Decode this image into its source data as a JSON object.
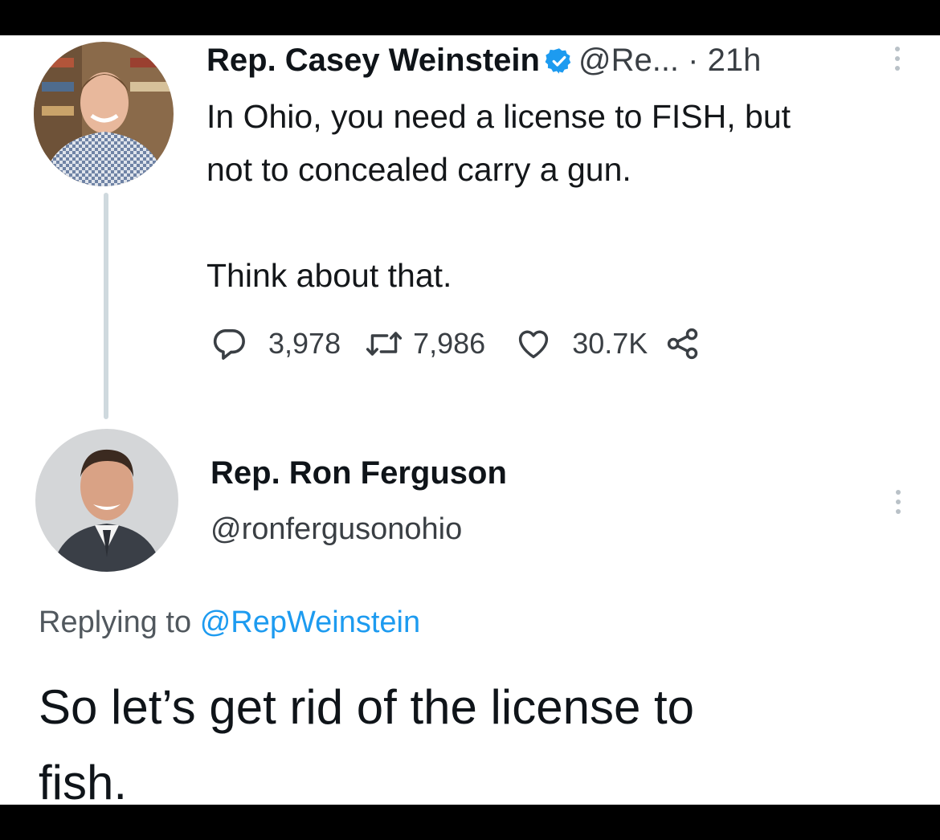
{
  "tweet": {
    "author_name": "Rep. Casey Weinstein",
    "handle": "@Re...",
    "separator": "·",
    "time": "21h",
    "text_lines": [
      "In Ohio, you need a license to FISH, but",
      "not to concealed carry a gun."
    ],
    "text_second": "Think about that.",
    "stats": {
      "replies": "3,978",
      "retweets": "7,986",
      "likes": "30.7K"
    }
  },
  "reply": {
    "author_name": "Rep. Ron Ferguson",
    "handle": "@ronfergusonohio",
    "replying_prefix": "Replying to",
    "replying_to": "@RepWeinstein",
    "text_lines": [
      "So let’s get rid of the license to",
      "fish."
    ]
  },
  "colors": {
    "verified_badge": "#1d9bf0",
    "mention": "#1d9bf0",
    "icon_gray": "#3a3f44",
    "thread_line": "#cfd9de"
  },
  "icons": {
    "verified": "verified-badge-icon",
    "reply": "reply-icon",
    "retweet": "retweet-icon",
    "like": "heart-icon",
    "share": "share-icon",
    "more": "more-options-icon"
  }
}
